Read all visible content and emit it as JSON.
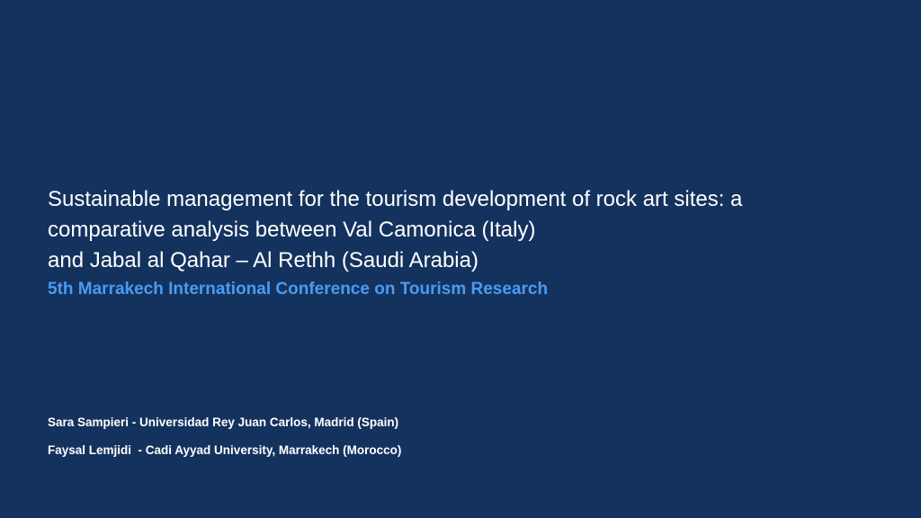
{
  "slide": {
    "title_lines": [
      "Sustainable management for the tourism development of rock art sites: a",
      "comparative analysis between Val Camonica (Italy)",
      "and Jabal al Qahar – Al Rethh (Saudi Arabia)"
    ],
    "subtitle": "5th Marrakech International Conference on Tourism Research",
    "authors": [
      "Sara Sampieri - Universidad Rey Juan Carlos, Madrid (Spain)",
      "Faysal Lemjidi  - Cadi Ayyad University, Marrakech (Morocco)"
    ],
    "colors": {
      "background": "#14325e",
      "title": "#ffffff",
      "subtitle": "#4a9bf0",
      "authors": "#ffffff"
    }
  }
}
